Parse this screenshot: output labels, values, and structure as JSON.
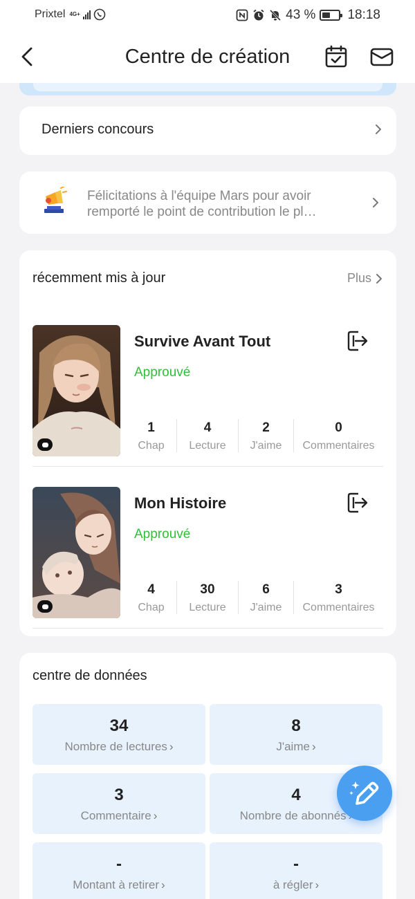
{
  "status_bar": {
    "carrier": "Prixtel",
    "network": "4G+",
    "battery": "43 %",
    "time": "18:18"
  },
  "header": {
    "title": "Centre de création"
  },
  "contest": {
    "label": "Derniers concours"
  },
  "notice": {
    "text": "Félicitations à l'équipe Mars pour avoir remporté le point de contribution le pl…"
  },
  "recent": {
    "title": "récemment mis à jour",
    "more": "Plus",
    "books": [
      {
        "title": "Survive Avant Tout",
        "status": "Approuvé",
        "stats": [
          {
            "value": "1",
            "label": "Chap"
          },
          {
            "value": "4",
            "label": "Lecture"
          },
          {
            "value": "2",
            "label": "J'aime"
          },
          {
            "value": "0",
            "label": "Commentaires"
          }
        ]
      },
      {
        "title": "Mon Histoire",
        "status": "Approuvé",
        "stats": [
          {
            "value": "4",
            "label": "Chap"
          },
          {
            "value": "30",
            "label": "Lecture"
          },
          {
            "value": "6",
            "label": "J'aime"
          },
          {
            "value": "3",
            "label": "Commentaires"
          }
        ]
      }
    ]
  },
  "data_center": {
    "title": "centre de données",
    "tiles": [
      {
        "value": "34",
        "label": "Nombre de lectures"
      },
      {
        "value": "8",
        "label": "J'aime"
      },
      {
        "value": "3",
        "label": "Commentaire"
      },
      {
        "value": "4",
        "label": "Nombre de abonnés"
      },
      {
        "value": "-",
        "label": "Montant à retirer"
      },
      {
        "value": "-",
        "label": "à régler"
      }
    ]
  },
  "colors": {
    "approved": "#2fbf3a",
    "accent": "#4a9ff0",
    "tile_bg": "#e8f2fd"
  },
  "icons": [
    "back-icon",
    "calendar-check-icon",
    "mail-icon",
    "chevron-right-icon",
    "trophy-megaphone-icon",
    "export-icon",
    "comment-icon",
    "pen-sparkle-icon"
  ]
}
